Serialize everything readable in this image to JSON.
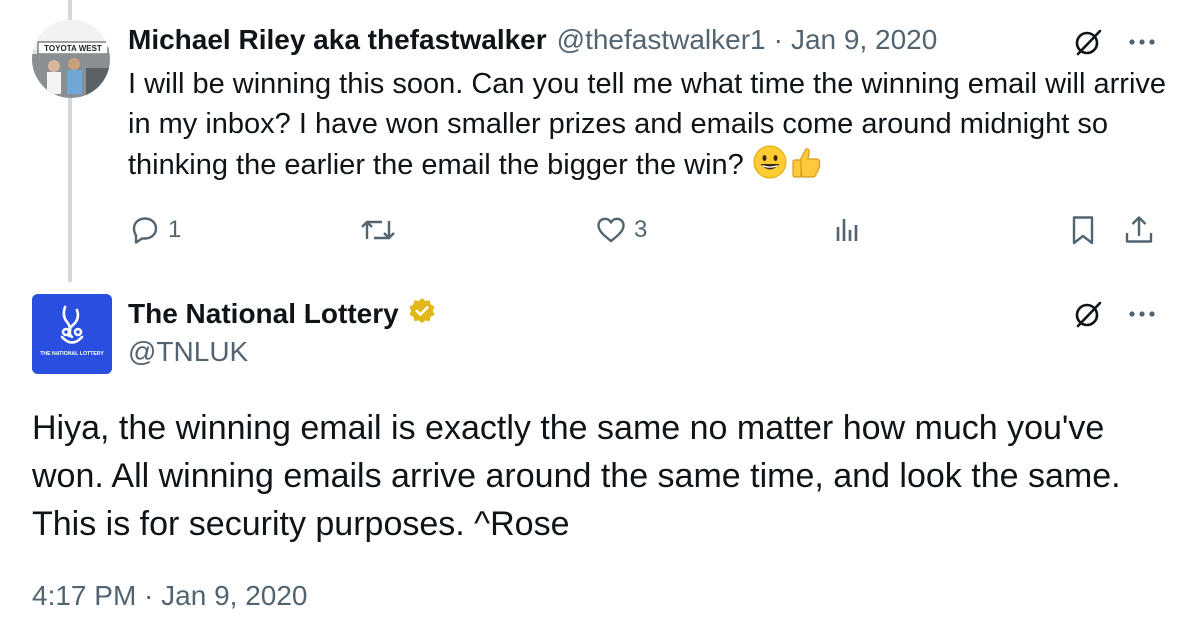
{
  "parent_tweet": {
    "author_name": "Michael Riley aka thefastwalker",
    "handle": "@thefastwalker1",
    "separator": "·",
    "date": "Jan 9, 2020",
    "avatar_sign_text": "TOYOTA WEST",
    "text": "I will be winning this soon. Can you tell me what time the winning email will arrive in my inbox? I have won smaller prizes and emails come around midnight so thinking the earlier the email the bigger the win?",
    "emojis": [
      "grinning-face-emoji",
      "thumbs-up-emoji"
    ],
    "actions": {
      "reply_count": "1",
      "retweet_count": "",
      "like_count": "3",
      "views_count": ""
    }
  },
  "main_tweet": {
    "author_name": "The National Lottery",
    "handle": "@TNLUK",
    "avatar_caption": "THE NATIONAL LOTTERY",
    "text": "Hiya, the winning email is exactly the same no matter how much you've won. All winning emails arrive around the same time, and look the same. This is for security purposes. ^Rose",
    "timestamp": "4:17 PM · Jan 9, 2020"
  },
  "icons": [
    "grok-icon",
    "more-icon",
    "reply-icon",
    "retweet-icon",
    "like-icon",
    "views-icon",
    "bookmark-icon",
    "share-icon",
    "verified-badge-icon"
  ],
  "colors": {
    "text_primary": "#0f1419",
    "text_secondary": "#536471",
    "thread_line": "#cfd9de",
    "lottery_blue": "#2a4fe0",
    "verified_gold": "#e2b719"
  }
}
